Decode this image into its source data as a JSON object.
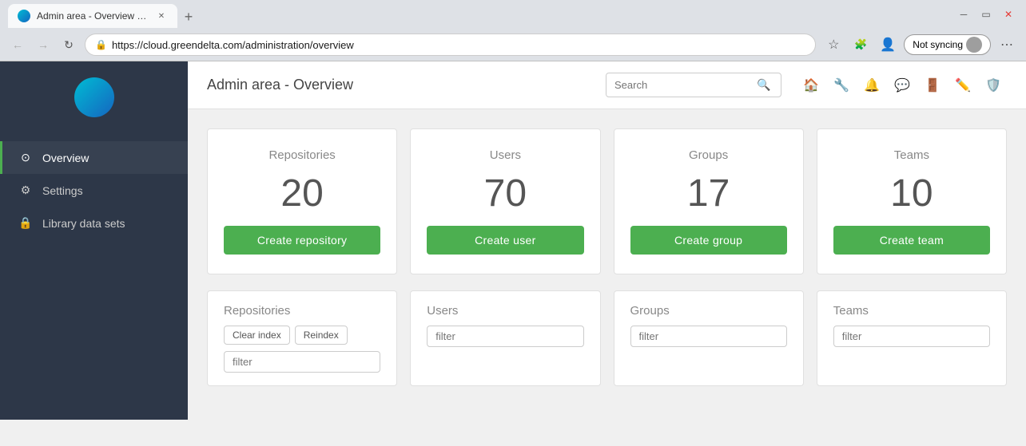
{
  "browser": {
    "tab_title": "Admin area - Overview | LCA Co...",
    "url": "https://cloud.greendelta.com/administration/overview",
    "new_tab_label": "+",
    "not_syncing_label": "Not syncing"
  },
  "header": {
    "page_title": "Admin area - Overview",
    "search_placeholder": "Search",
    "icons": [
      "home",
      "wrench",
      "bell",
      "comment",
      "sign-out",
      "edit",
      "shield"
    ]
  },
  "sidebar": {
    "items": [
      {
        "id": "overview",
        "label": "Overview",
        "icon": "⊙",
        "active": true
      },
      {
        "id": "settings",
        "label": "Settings",
        "icon": "⚙"
      },
      {
        "id": "library",
        "label": "Library data sets",
        "icon": "🔒"
      }
    ]
  },
  "cards": [
    {
      "id": "repositories",
      "title": "Repositories",
      "count": "20",
      "button_label": "Create repository"
    },
    {
      "id": "users",
      "title": "Users",
      "count": "70",
      "button_label": "Create user"
    },
    {
      "id": "groups",
      "title": "Groups",
      "count": "17",
      "button_label": "Create group"
    },
    {
      "id": "teams",
      "title": "Teams",
      "count": "10",
      "button_label": "Create team"
    }
  ],
  "bottom_sections": [
    {
      "id": "repositories",
      "title": "Repositories",
      "has_index_buttons": true,
      "clear_index_label": "Clear index",
      "reindex_label": "Reindex",
      "filter_placeholder": "filter"
    },
    {
      "id": "users",
      "title": "Users",
      "has_index_buttons": false,
      "filter_placeholder": "filter"
    },
    {
      "id": "groups",
      "title": "Groups",
      "has_index_buttons": false,
      "filter_placeholder": "filter"
    },
    {
      "id": "teams",
      "title": "Teams",
      "has_index_buttons": false,
      "filter_placeholder": "filter"
    }
  ]
}
